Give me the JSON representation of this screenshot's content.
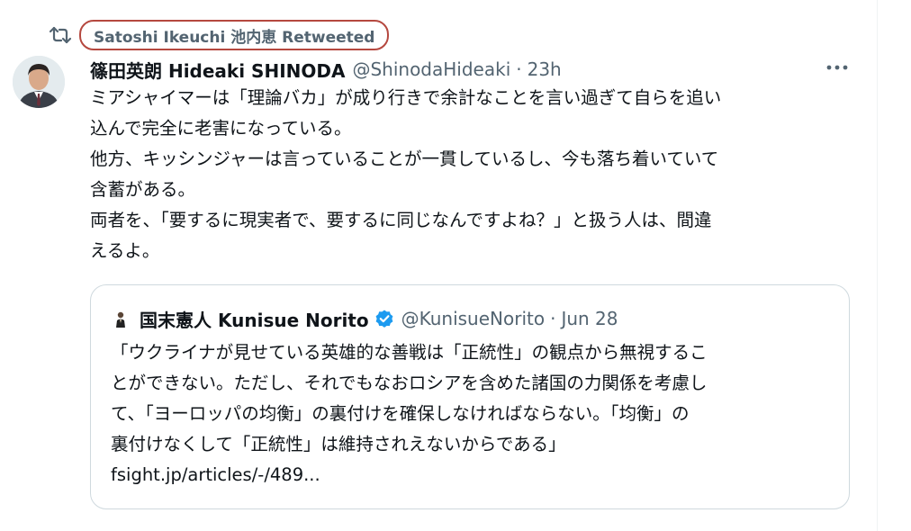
{
  "retweet": {
    "icon": "retweet-icon",
    "text": "Satoshi Ikeuchi 池内恵 Retweeted",
    "highlight_color": "#b5483f"
  },
  "tweet": {
    "author_name": "篠田英朗 Hideaki SHINODA",
    "handle": "@ShinodaHideaki",
    "separator": "·",
    "time": "23h",
    "more_icon": "more-horizontal-icon",
    "lines": [
      "ミアシャイマーは「理論バカ」が成り行きで余計なことを言い過ぎて自らを追い",
      "込んで完全に老害になっている。",
      "他方、キッシンジャーは言っていることが一貫しているし、今も落ち着いていて",
      "含蓄がある。",
      "両者を、「要するに現実者で、要するに同じなんですよね？」と扱う人は、間違",
      "えるよ。"
    ]
  },
  "quoted": {
    "author_name": "国末憲人 Kunisue Norito",
    "verified_icon": "verified-badge-icon",
    "verified_color": "#1d9bf0",
    "handle": "@KunisueNorito",
    "separator": "·",
    "date": "Jun 28",
    "lines": [
      "「ウクライナが見せている英雄的な善戦は「正統性」の観点から無視するこ",
      "とができない。ただし、それでもなおロシアを含めた諸国の力関係を考慮し",
      "て、「ヨーロッパの均衡」の裏付けを確保しなければならない。「均衡」の",
      "裏付けなくして「正統性」は維持されえないからである」",
      "fsight.jp/articles/-/489..."
    ]
  }
}
